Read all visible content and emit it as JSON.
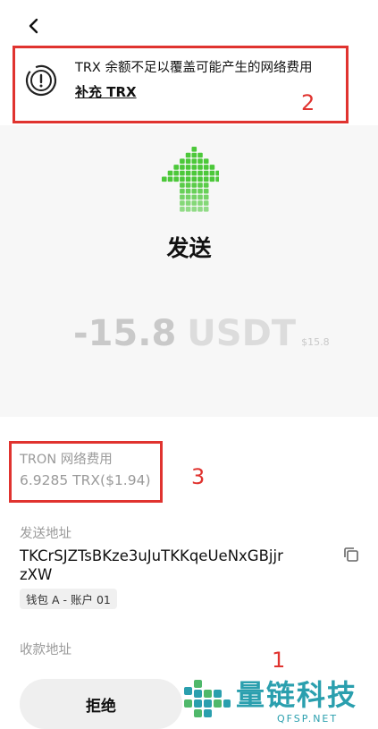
{
  "header": {
    "back_icon": "chevron-left-icon"
  },
  "banner": {
    "icon": "alert-circle-icon",
    "message": "TRX 余额不足以覆盖可能产生的网络费用",
    "action_label": "补充 TRX"
  },
  "transaction": {
    "icon": "send-arrow-icon",
    "type_label": "发送",
    "amount": "-15.8",
    "unit": "USDT",
    "fiat": "$15.8"
  },
  "fee": {
    "label": "TRON 网络费用",
    "value": "6.9285 TRX($1.94)"
  },
  "sender": {
    "label": "发送地址",
    "address": "TKCrSJZTsBKze3uJuTKKqeUeNxGBjjrzXW",
    "wallet_tag": "钱包 A - 账户 01",
    "copy_icon": "copy-icon"
  },
  "receiver": {
    "label": "收款地址"
  },
  "actions": {
    "reject_label": "拒绝"
  },
  "annotations": {
    "box1": "1",
    "box2": "2",
    "box3": "3",
    "color": "#e0332f"
  },
  "watermark": {
    "title": "量链科技",
    "subtitle": "QFSP.NET",
    "color": "#2a9fae"
  },
  "colors": {
    "accent_green": "#4cc83a",
    "muted_text": "#9a9a9a"
  }
}
